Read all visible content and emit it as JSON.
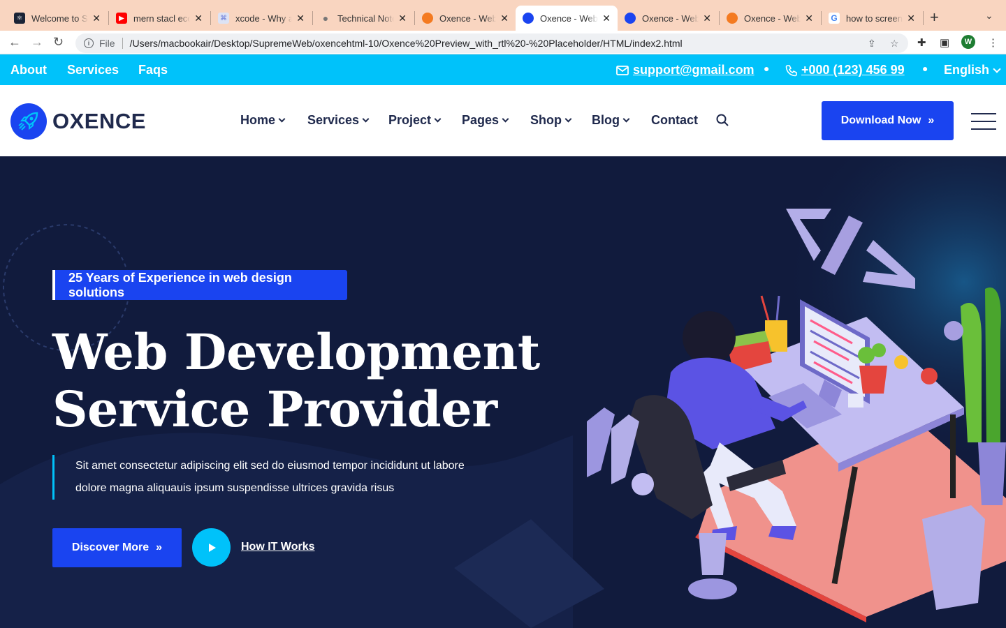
{
  "browser": {
    "tabs": [
      {
        "title": "Welcome to Supreme",
        "icon": "react-icon",
        "color": "#1b2436"
      },
      {
        "title": "mern stacl ecommerce",
        "icon": "youtube-icon",
        "color": "#ff0000"
      },
      {
        "title": "xcode - Why am I",
        "icon": "stackoverflow-icon",
        "color": "#f48024"
      },
      {
        "title": "Technical Note",
        "icon": "apple-icon",
        "color": "#777777"
      },
      {
        "title": "Oxence - Web",
        "icon": "oxence-orange-icon",
        "color": "#f47a20"
      },
      {
        "title": "Oxence - Web",
        "icon": "oxence-blue-icon",
        "color": "#1a44f0",
        "active": true
      },
      {
        "title": "Oxence - Web",
        "icon": "oxence-blue-icon",
        "color": "#1a44f0"
      },
      {
        "title": "Oxence - Web",
        "icon": "oxence-orange-icon",
        "color": "#f47a20"
      },
      {
        "title": "how to screen",
        "icon": "google-icon",
        "color": "#4285f4"
      }
    ],
    "address": {
      "scheme_label": "File",
      "url": "/Users/macbookair/Desktop/SupremeWeb/oxencehtml-10/Oxence%20Preview_with_rtl%20-%20Placeholder/HTML/index2.html"
    },
    "profile_initial": "W"
  },
  "topbar": {
    "links": [
      "About",
      "Services",
      "Faqs"
    ],
    "email": "support@gmail.com",
    "phone": "+000 (123) 456 99",
    "language": "English"
  },
  "header": {
    "logo_text": "OXENCE",
    "menu": [
      "Home",
      "Services",
      "Project",
      "Pages",
      "Shop",
      "Blog",
      "Contact"
    ],
    "cta": "Download Now"
  },
  "hero": {
    "badge": "25 Years of Experience in web design solutions",
    "title_line1": "Web Development",
    "title_line2": "Service Provider",
    "lead_line1": "Sit amet consectetur adipiscing elit sed do eiusmod tempor incididunt ut labore",
    "lead_line2": "dolore magna aliquauis ipsum suspendisse ultrices gravida risus",
    "primary_button": "Discover More",
    "secondary_link": "How IT Works"
  },
  "colors": {
    "accent": "#1a44f0",
    "cyan": "#00c2fa",
    "dark": "#111b3d"
  }
}
